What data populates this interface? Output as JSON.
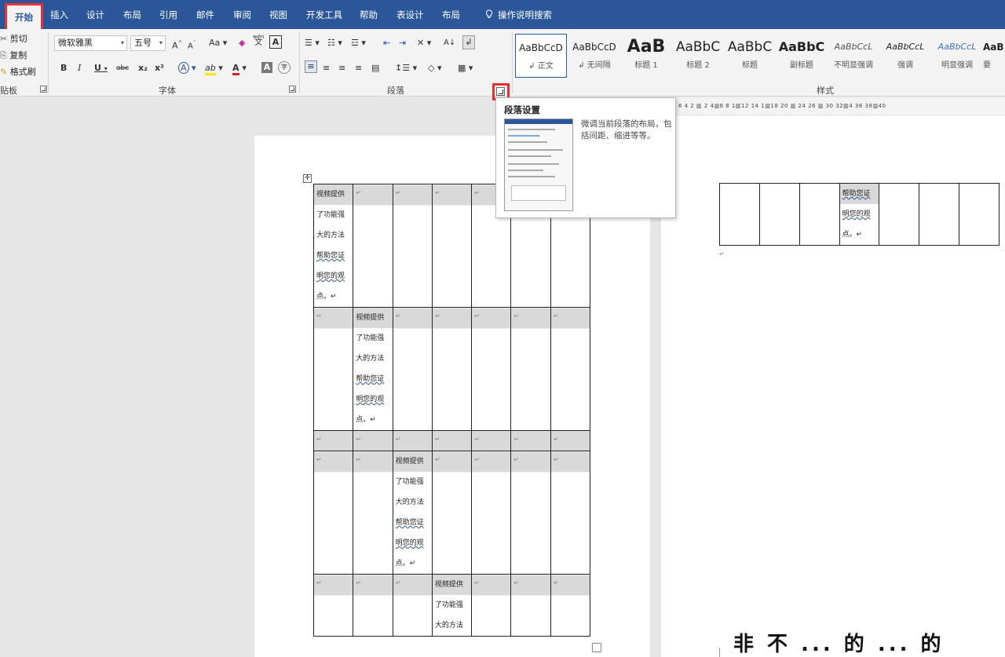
{
  "tabs": {
    "home": "开始",
    "insert": "插入",
    "design": "设计",
    "layout": "布局",
    "references": "引用",
    "mailings": "邮件",
    "review": "审阅",
    "view": "视图",
    "developer": "开发工具",
    "help": "帮助",
    "table_design": "表设计",
    "table_layout": "布局",
    "search": "操作说明搜索"
  },
  "clipboard": {
    "cut": "剪切",
    "copy": "复制",
    "format_painter": "格式刷",
    "group_label": "贴板"
  },
  "font": {
    "font_name": "微软雅黑",
    "font_size": "五号",
    "grow": "A",
    "shrink": "A",
    "change_case": "Aa",
    "phonetic_top": "wén",
    "phonetic_bottom": "文",
    "border_char": "A",
    "bold": "B",
    "italic": "I",
    "underline": "U",
    "strikethrough": "abc",
    "subscript": "x₂",
    "superscript": "x²",
    "effects": "A",
    "highlight": "ab",
    "color": "A",
    "shading": "A",
    "enclose": "字",
    "group_label": "字体"
  },
  "paragraph": {
    "group_label": "段落",
    "sort": "A↓"
  },
  "styles": {
    "group_label": "样式",
    "items": [
      {
        "preview": "AaBbCcD",
        "label": "↲ 正文"
      },
      {
        "preview": "AaBbCcD",
        "label": "↲ 无间隔"
      },
      {
        "preview": "AaB",
        "label": "标题 1"
      },
      {
        "preview": "AaBbC",
        "label": "标题 2"
      },
      {
        "preview": "AaBbC",
        "label": "标题"
      },
      {
        "preview": "AaBbC",
        "label": "副标题"
      },
      {
        "preview": "AaBbCcL",
        "label": "不明显强调"
      },
      {
        "preview": "AaBbCcL",
        "label": "强调"
      },
      {
        "preview": "AaBbCcL",
        "label": "明显强调"
      },
      {
        "preview": "AaB",
        "label": "要"
      }
    ]
  },
  "ruler": {
    "ticks": "6 4 2 ▥ 2 4▥6 8 1▥12 14 1▥18 20 ▥ 24 26 ▥ 30 32▥4 36 38▥40"
  },
  "tooltip": {
    "title": "段落设置",
    "description": "微调当前段落的布局，包括间距、缩进等等。"
  },
  "document": {
    "cell_lines": [
      "视频提供",
      "了功能强",
      "大的方法",
      "帮助您证",
      "明您的观",
      "点。↵"
    ],
    "mark": "↵"
  },
  "bottom_text": "非 不 ... 的 ... 的"
}
